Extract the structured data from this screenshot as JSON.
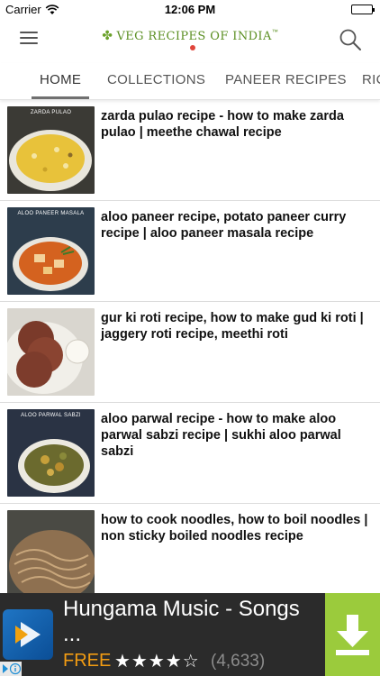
{
  "status_bar": {
    "carrier": "Carrier",
    "time": "12:06 PM"
  },
  "header": {
    "logo_text": "VEG RECIPES OF INDIA",
    "logo_tm": "™"
  },
  "tabs": [
    {
      "label": "HOME",
      "active": true
    },
    {
      "label": "COLLECTIONS",
      "active": false
    },
    {
      "label": "PANEER RECIPES",
      "active": false
    },
    {
      "label": "RIC",
      "active": false
    }
  ],
  "recipes": [
    {
      "title": "zarda pulao recipe - how to make zarda pulao | meethe chawal recipe",
      "thumb_caption": "ZARDA PULAO"
    },
    {
      "title": "aloo paneer recipe, potato paneer curry recipe | aloo paneer masala recipe",
      "thumb_caption": "ALOO PANEER MASALA"
    },
    {
      "title": "gur ki roti recipe, how to make gud ki roti | jaggery roti recipe, meethi roti",
      "thumb_caption": ""
    },
    {
      "title": "aloo parwal recipe - how to make aloo parwal sabzi recipe | sukhi aloo parwal sabzi",
      "thumb_caption": "ALOO PARWAL SABZI"
    },
    {
      "title": "how to cook noodles, how to boil noodles | non sticky boiled noodles recipe",
      "thumb_caption": ""
    }
  ],
  "ad": {
    "title": "Hungama Music - Songs",
    "ellipsis": "...",
    "price": "FREE",
    "stars": "★★★★☆",
    "rating_count": "(4,633)",
    "accent_color": "#9bcb3c"
  }
}
